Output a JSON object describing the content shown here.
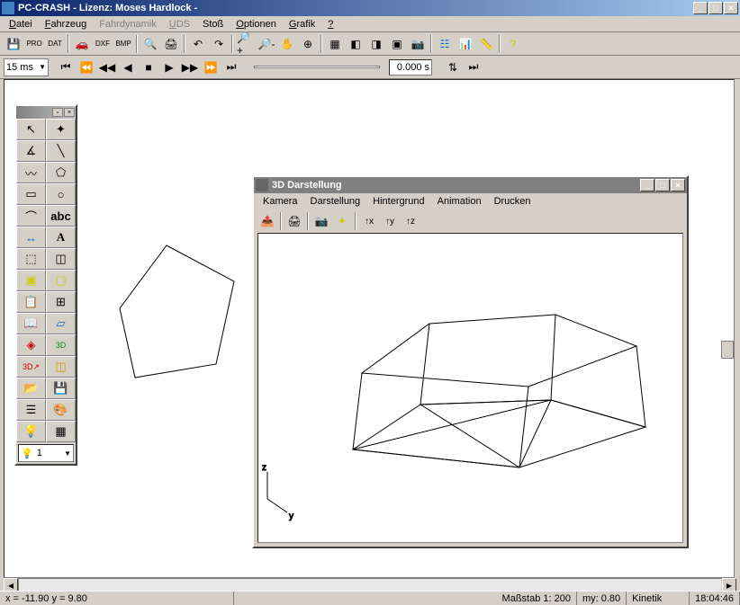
{
  "window": {
    "title": "PC-CRASH - Lizenz: Moses Hardlock -"
  },
  "menu": {
    "items": [
      {
        "label": "Datei",
        "key": "D",
        "enabled": true
      },
      {
        "label": "Fahrzeug",
        "key": "F",
        "enabled": true
      },
      {
        "label": "Fahrdynamik",
        "key": "",
        "enabled": false
      },
      {
        "label": "UDS",
        "key": "U",
        "enabled": false
      },
      {
        "label": "Stoß",
        "key": "",
        "enabled": true
      },
      {
        "label": "Optionen",
        "key": "O",
        "enabled": true
      },
      {
        "label": "Grafik",
        "key": "G",
        "enabled": true
      },
      {
        "label": "?",
        "key": "?",
        "enabled": true
      }
    ]
  },
  "toolbar2": {
    "time_step": "15 ms",
    "time_value": "0.000 s"
  },
  "tool_palette": {
    "layer": "1"
  },
  "subwindow": {
    "title": "3D Darstellung",
    "menu": [
      "Kamera",
      "Darstellung",
      "Hintergrund",
      "Animation",
      "Drucken"
    ],
    "axes": {
      "y": "y",
      "z": "z"
    }
  },
  "status": {
    "coords": "x = -11.90 y = 9.80",
    "scale": "Maßstab 1: 200",
    "my": "my: 0.80",
    "mode": "Kinetik",
    "time": "18:04:46"
  }
}
